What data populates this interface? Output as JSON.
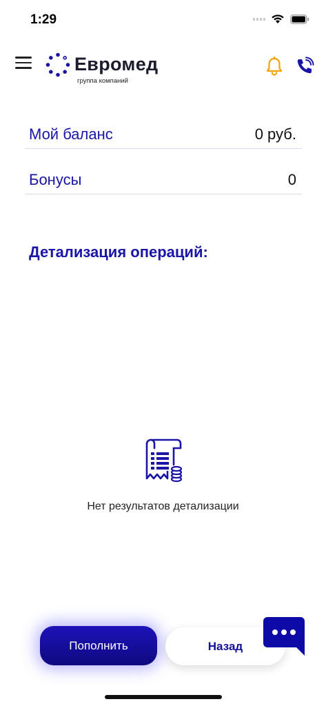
{
  "status_bar": {
    "time": "1:29"
  },
  "header": {
    "brand_name": "Евромед",
    "brand_tagline": "группа компаний",
    "icons": [
      "menu-icon",
      "bell-icon",
      "phone-icon"
    ],
    "colors": {
      "brand": "#1a15a6",
      "bell": "#f5a300"
    }
  },
  "balance": {
    "label": "Мой баланс",
    "value": "0 руб."
  },
  "bonuses": {
    "label": "Бонусы",
    "value": "0"
  },
  "details": {
    "title": "Детализация операций:",
    "empty_text": "Нет результатов детализации",
    "empty_icon": "receipt-icon"
  },
  "actions": {
    "topup_label": "Пополнить",
    "back_label": "Назад",
    "chat_icon": "chat-icon"
  }
}
